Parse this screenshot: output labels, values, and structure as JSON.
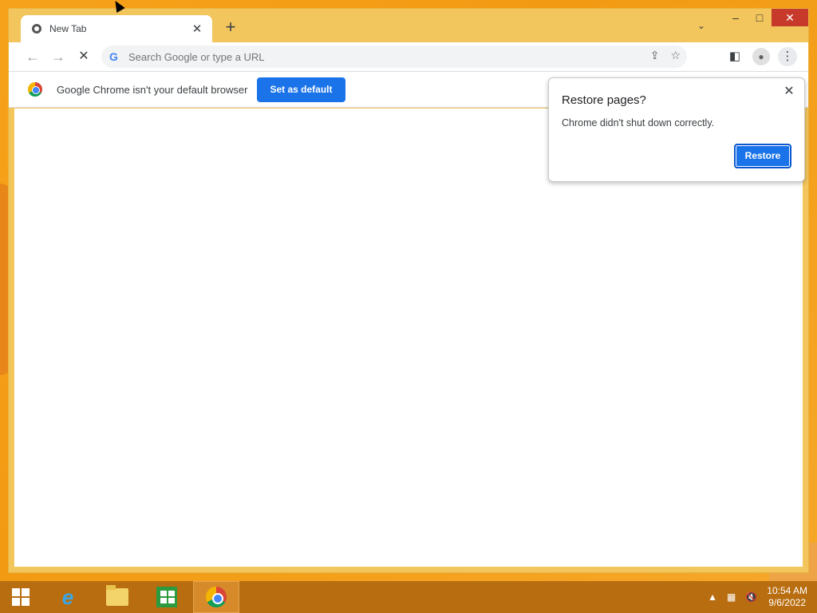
{
  "window": {
    "tab": {
      "title": "New Tab"
    },
    "controls": {
      "minimize": "–",
      "maximize": "□",
      "close": "✕"
    }
  },
  "toolbar": {
    "omnibox_placeholder": "Search Google or type a URL"
  },
  "infobar": {
    "message": "Google Chrome isn't your default browser",
    "button": "Set as default"
  },
  "restore_bubble": {
    "title": "Restore pages?",
    "message": "Chrome didn't shut down correctly.",
    "button": "Restore"
  },
  "taskbar": {
    "time": "10:54 AM",
    "date": "9/6/2022"
  },
  "colors": {
    "accent": "#1a73e8",
    "titlebar": "#f2c55d",
    "taskbar": "#b86e10",
    "desktop": "#f29a12"
  }
}
